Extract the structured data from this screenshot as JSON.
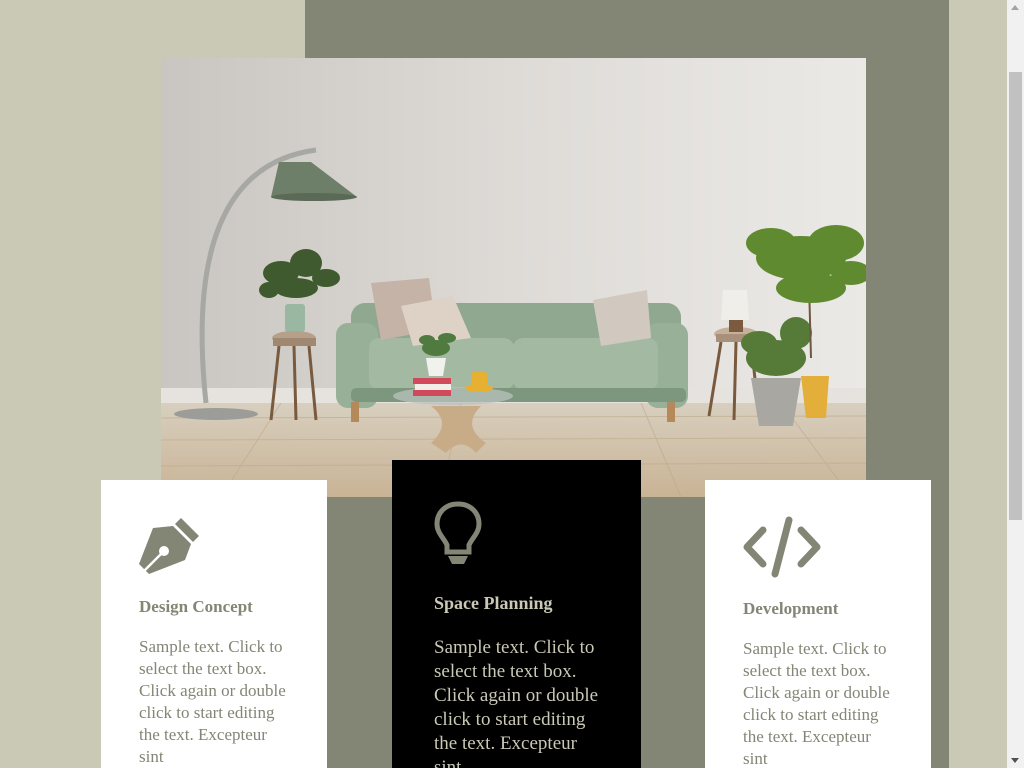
{
  "colors": {
    "background": "#cac9b6",
    "accent": "#838575",
    "card_light": "#ffffff",
    "card_dark": "#000000"
  },
  "hero": {
    "image_icon": "living-room-photo"
  },
  "cards": [
    {
      "icon": "pen-nib-icon",
      "title": "Design Concept",
      "text": "Sample text. Click to select the text box. Click again or double click to start editing the text. Excepteur sint"
    },
    {
      "icon": "lightbulb-icon",
      "title": "Space Planning",
      "text": "Sample text. Click to select the text box. Click again or double click to start editing the text. Excepteur sint"
    },
    {
      "icon": "code-icon",
      "title": "Development",
      "text": "Sample text. Click to select the text box. Click again or double click to start editing the text. Excepteur sint"
    }
  ]
}
